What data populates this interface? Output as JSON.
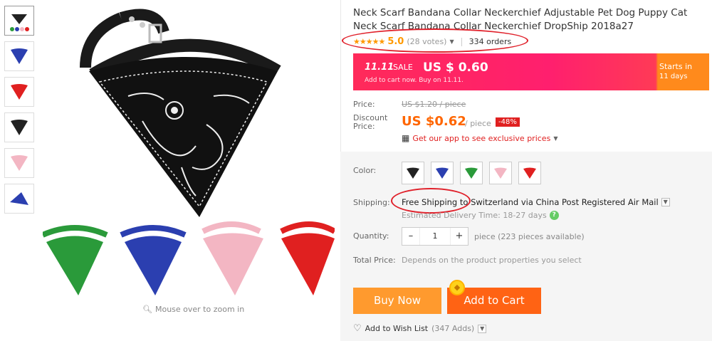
{
  "gallery": {
    "thumbnails": [
      "black-green-mix-thumb",
      "blue-thumb",
      "red-thumb",
      "black-thumb",
      "pink-thumb",
      "blue-side-thumb"
    ],
    "zoom_hint": "Mouse over to zoom in"
  },
  "product": {
    "title": "Neck Scarf Bandana Collar Neckerchief Adjustable Pet Dog Puppy Cat Neck Scarf Bandana Collar Neckerchief DropShip 2018a27",
    "stars": "★★★★★",
    "rating": "5.0",
    "votes": "(28 votes)",
    "orders": "334 orders"
  },
  "sale": {
    "tag": "11.11",
    "tag_word": "SALE",
    "price": "US $ 0.60",
    "note": "Add to cart now. Buy on 11.11.",
    "starts_label": "Starts in",
    "starts_value": "11 days"
  },
  "pricing": {
    "price_label": "Price:",
    "original": "US $1.20 / piece",
    "discount_label": "Discount Price:",
    "discount_price": "US $0.62",
    "unit": "/ piece",
    "discount_pct": "-48%",
    "app_link": "Get our app to see exclusive prices"
  },
  "options": {
    "color_label": "Color:",
    "colors": [
      "#222222",
      "#2b3fb0",
      "#2a9a3a",
      "#f3b6c3",
      "#e02020"
    ],
    "shipping_label": "Shipping:",
    "shipping_text": "Free Shipping to Switzerland via China Post Registered Air Mail",
    "delivery": "Estimated Delivery Time: 18-27 days",
    "quantity_label": "Quantity:",
    "quantity": "1",
    "available": "piece (223 pieces available)",
    "total_label": "Total Price:",
    "total_text": "Depends on the product properties you select"
  },
  "actions": {
    "buy_now": "Buy Now",
    "add_to_cart": "Add to Cart",
    "wish_label": "Add to Wish List",
    "wish_count": "(347 Adds)"
  }
}
